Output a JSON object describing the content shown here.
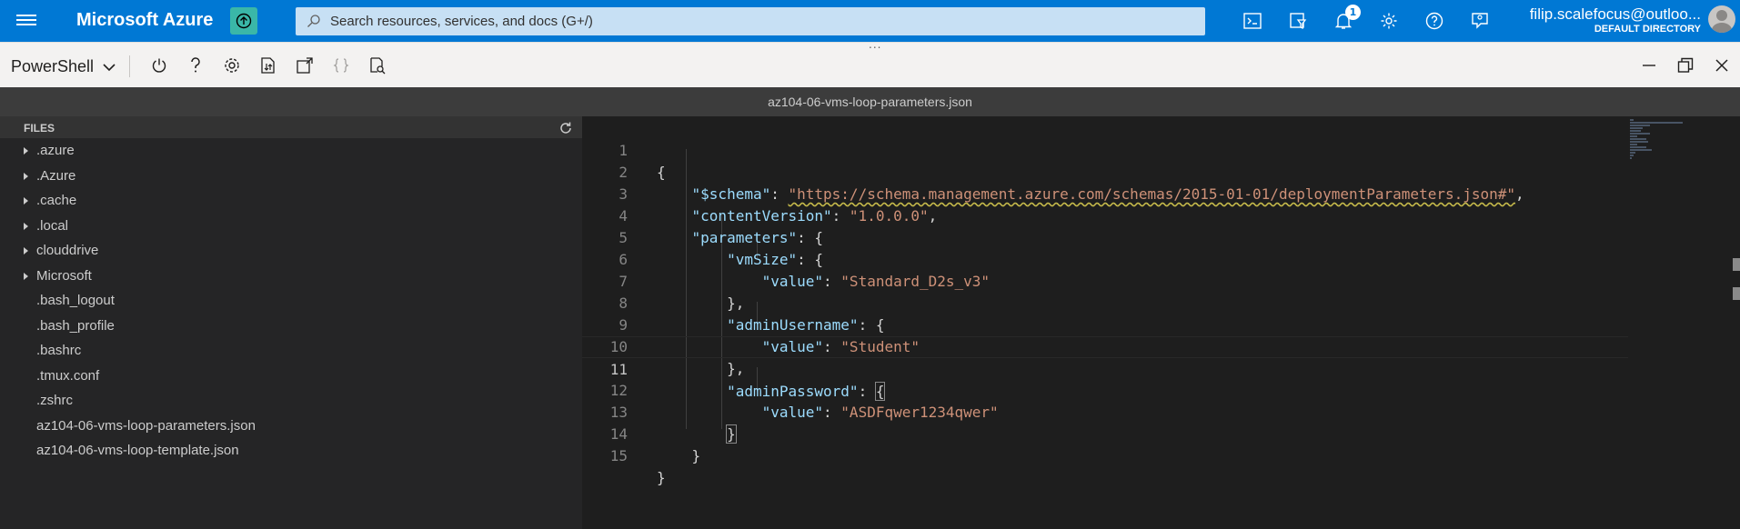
{
  "topbar": {
    "brand": "Microsoft Azure",
    "search_placeholder": "Search resources, services, and docs (G+/)",
    "notification_count": "1",
    "account_email": "filip.scalefocus@outloo...",
    "account_directory": "DEFAULT DIRECTORY",
    "icons": [
      "cloud-shell-icon",
      "directory-filter-icon",
      "notifications-icon",
      "settings-icon",
      "help-icon",
      "feedback-icon"
    ]
  },
  "shell": {
    "selected_shell": "PowerShell",
    "tools": [
      "power-icon",
      "help-icon",
      "settings-icon",
      "upload-download-icon",
      "open-new-session-icon",
      "editor-braces-icon",
      "web-preview-icon"
    ],
    "drag_handle": "..."
  },
  "editor": {
    "file_title": "az104-06-vms-loop-parameters.json",
    "explorer_header": "FILES",
    "folders": [
      ".azure",
      ".Azure",
      ".cache",
      ".local",
      "clouddrive",
      "Microsoft"
    ],
    "files": [
      ".bash_logout",
      ".bash_profile",
      ".bashrc",
      ".tmux.conf",
      ".zshrc",
      "az104-06-vms-loop-parameters.json",
      "az104-06-vms-loop-template.json"
    ],
    "line_numbers": [
      "1",
      "2",
      "3",
      "4",
      "5",
      "6",
      "7",
      "8",
      "9",
      "10",
      "11",
      "12",
      "13",
      "14",
      "15"
    ],
    "active_line": "11",
    "code": {
      "l1_open": "{",
      "schema_key": "\"$schema\"",
      "schema_val": "\"https://schema.management.azure.com/schemas/2015-01-01/deploymentParameters.json#\"",
      "cv_key": "\"contentVersion\"",
      "cv_val": "\"1.0.0.0\"",
      "params_key": "\"parameters\"",
      "vmsize_key": "\"vmSize\"",
      "value_key": "\"value\"",
      "vmsize_val": "\"Standard_D2s_v3\"",
      "admin_user_key": "\"adminUsername\"",
      "admin_user_val": "\"Student\"",
      "admin_pass_key": "\"adminPassword\"",
      "admin_pass_val": "\"ASDFqwer1234qwer\""
    }
  },
  "colors": {
    "azure_blue": "#0078d4",
    "json_key": "#9cdcfe",
    "json_string": "#ce9178",
    "editor_bg": "#1e1e1e"
  }
}
